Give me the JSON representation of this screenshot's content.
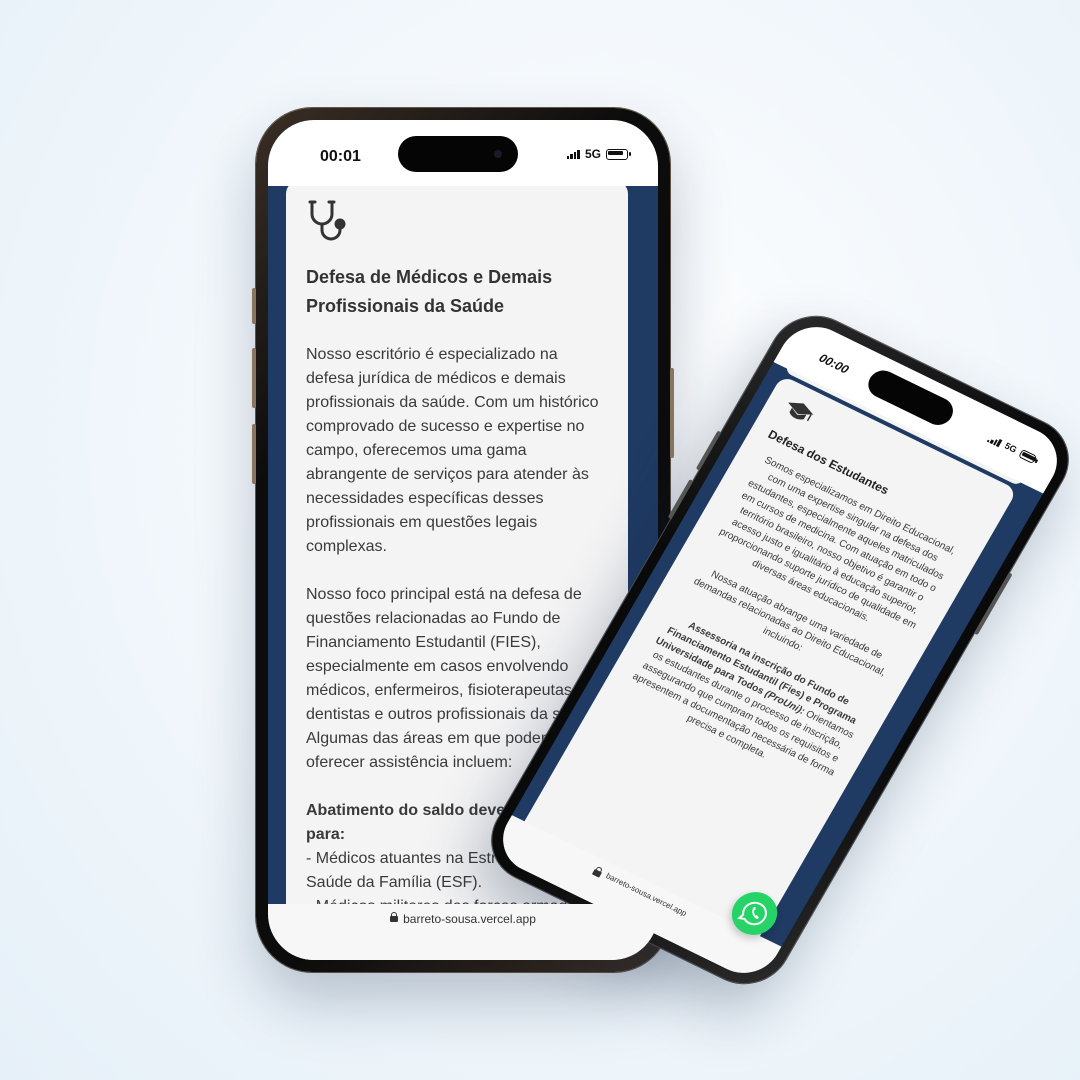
{
  "back_phone": {
    "status": {
      "time": "00:01",
      "network": "5G"
    },
    "card": {
      "icon": "stethoscope-icon",
      "title": "Defesa de Médicos e Demais Profissionais da Saúde",
      "paragraph_1": "Nosso escritório é especializado na defesa jurídica de médicos e demais profissionais da saúde. Com um histórico comprovado de sucesso e expertise no campo, oferecemos uma gama abrangente de serviços para atender às necessidades específicas desses profissionais em questões legais complexas.",
      "paragraph_2": "Nosso foco principal está na defesa de questões relacionadas ao Fundo de Financiamento Estudantil (FIES), especialmente em casos envolvendo médicos, enfermeiros, fisioterapeutas, dentistas e outros profissionais da saúde. Algumas das áreas em que podemos oferecer assistência incluem:",
      "subheading": "Abatimento do saldo devedor do FIES para:",
      "item_1": "- Médicos atuantes na Estratégia de Saúde da Família (ESF).",
      "item_2": "- Médicos militares das forças armadas."
    },
    "url": "barreto-sousa.vercel.app"
  },
  "front_phone": {
    "status": {
      "time": "00:00",
      "network": "5G"
    },
    "card": {
      "icon": "graduation-cap-icon",
      "title": "Defesa dos Estudantes",
      "paragraph_1": "Somos especializamos em Direito Educacional, com uma expertise singular na defesa dos estudantes, especialmente aqueles matriculados em cursos de medicina. Com atuação em todo o território brasileiro, nosso objetivo é garantir o acesso justo e igualitário à educação superior, proporcionando suporte jurídico de qualidade em diversas áreas educacionais.",
      "paragraph_2": "Nossa atuação abrange uma variedade de demandas relacionadas ao Direito Educacional, incluindo:",
      "item_heading": "Assessoria na inscrição do Fundo de Financiamento Estudantil (Fies) e Programa Universidade para Todos",
      "item_prouni": "(ProUni):",
      "item_text": " Orientamos os estudantes durante o processo de inscrição, assegurando que cumpram todos os requisitos e apresentem a documentação necessária de forma precisa e completa."
    },
    "url": "barreto-sousa.vercel.app",
    "whatsapp_icon": "whatsapp-icon"
  },
  "colors": {
    "site_background": "#1f3a63",
    "card": "#f4f4f5",
    "whatsapp": "#25d366"
  }
}
